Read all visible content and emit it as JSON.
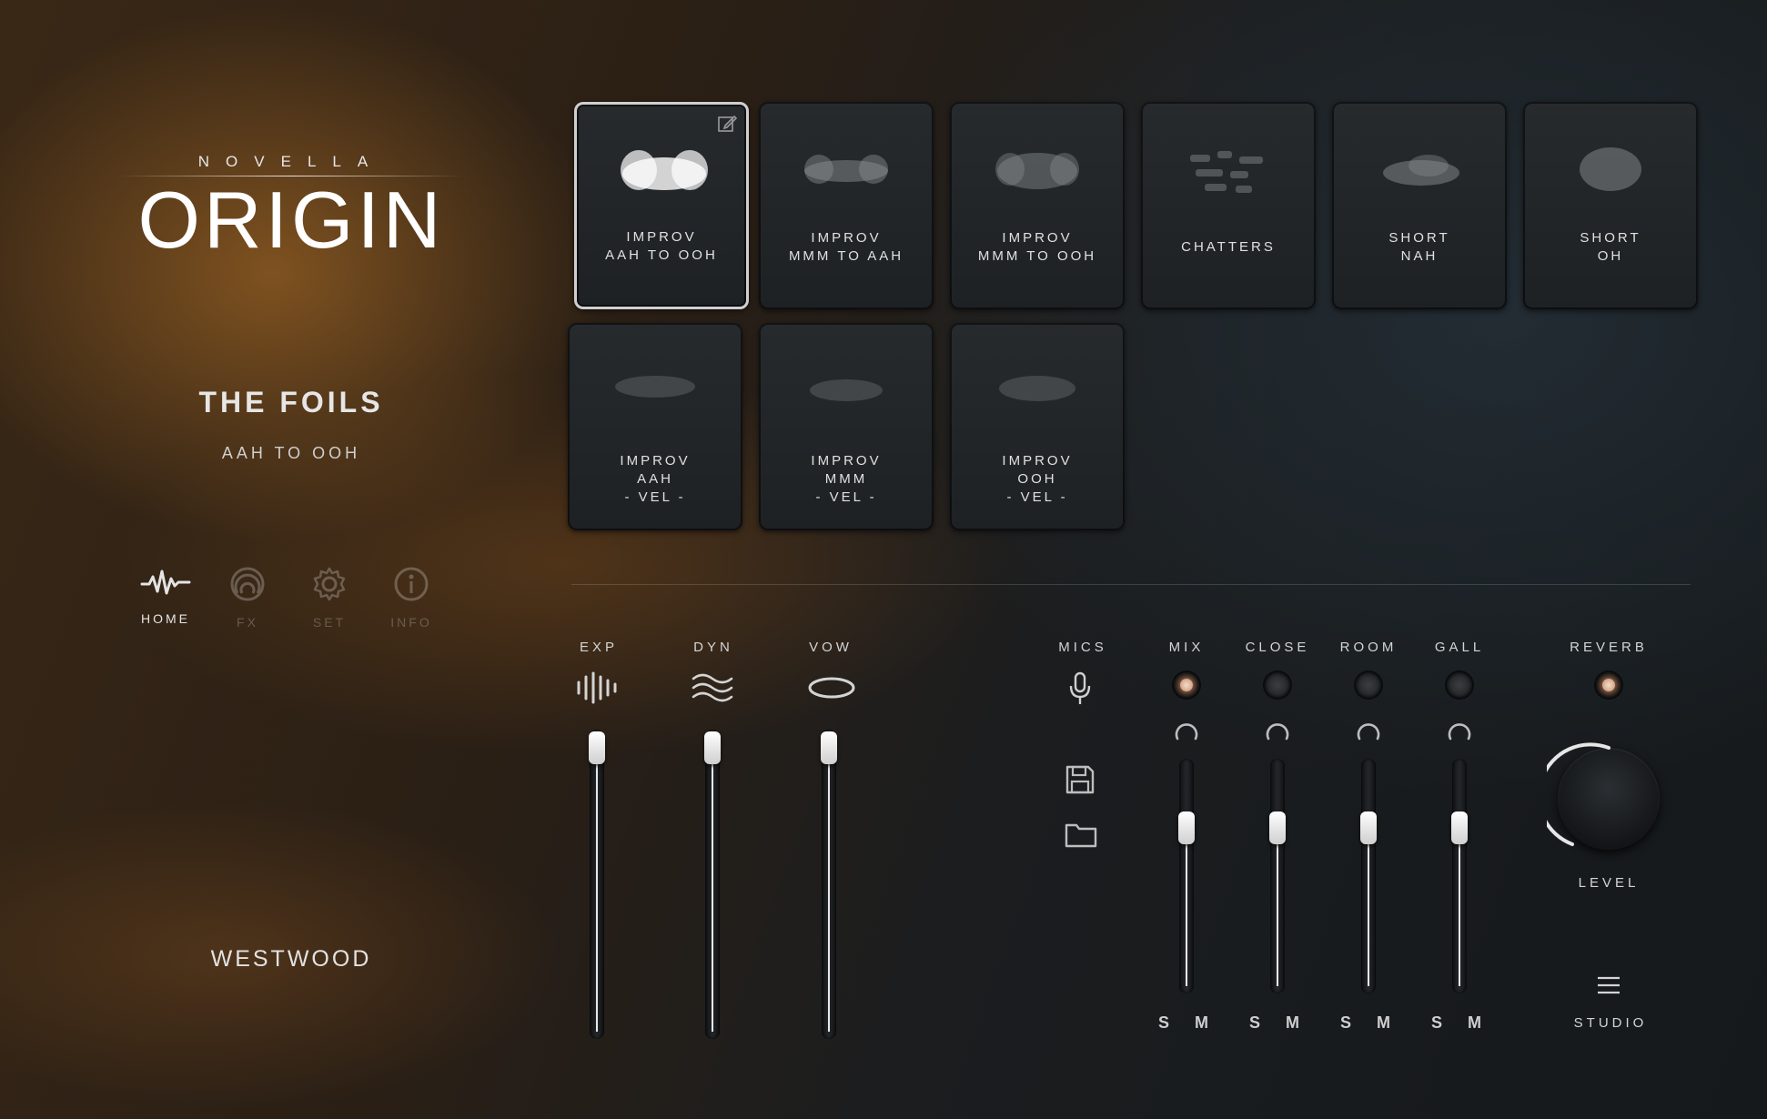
{
  "brand": {
    "top": "NOVELLA",
    "main": "ORIGIN"
  },
  "patch": {
    "title": "THE FOILS",
    "subtitle": "AAH TO OOH"
  },
  "nav": [
    {
      "label": "HOME",
      "icon": "waveform-icon",
      "active": true
    },
    {
      "label": "FX",
      "icon": "fx-rings-icon",
      "active": false
    },
    {
      "label": "SET",
      "icon": "gear-icon",
      "active": false
    },
    {
      "label": "INFO",
      "icon": "info-icon",
      "active": false
    }
  ],
  "maker": "WESTWOOD",
  "pads": [
    {
      "lines": [
        "IMPROV",
        "AAH TO OOH"
      ],
      "selected": true
    },
    {
      "lines": [
        "IMPROV",
        "MMM TO AAH"
      ],
      "selected": false
    },
    {
      "lines": [
        "IMPROV",
        "MMM TO OOH"
      ],
      "selected": false
    },
    {
      "lines": [
        "CHATTERS"
      ],
      "selected": false
    },
    {
      "lines": [
        "SHORT",
        "NAH"
      ],
      "selected": false
    },
    {
      "lines": [
        "SHORT",
        "OH"
      ],
      "selected": false
    },
    {
      "lines": [
        "IMPROV",
        "AAH",
        "- VEL -"
      ],
      "selected": false
    },
    {
      "lines": [
        "IMPROV",
        "MMM",
        "- VEL -"
      ],
      "selected": false
    },
    {
      "lines": [
        "IMPROV",
        "OOH",
        "- VEL -"
      ],
      "selected": false
    }
  ],
  "controls": {
    "exp": {
      "label": "EXP",
      "icon": "bars-icon",
      "value": 0.95
    },
    "dyn": {
      "label": "DYN",
      "icon": "waves-icon",
      "value": 0.95
    },
    "vow": {
      "label": "VOW",
      "icon": "ellipse-icon",
      "value": 0.95
    }
  },
  "mics": {
    "label": "MICS",
    "icons": [
      "microphone-icon",
      "save-icon",
      "folder-icon"
    ],
    "channels": [
      {
        "label": "MIX",
        "on": true,
        "value": 0.72,
        "solo": "S",
        "mute": "M"
      },
      {
        "label": "CLOSE",
        "on": false,
        "value": 0.72,
        "solo": "S",
        "mute": "M"
      },
      {
        "label": "ROOM",
        "on": false,
        "value": 0.72,
        "solo": "S",
        "mute": "M"
      },
      {
        "label": "GALL",
        "on": false,
        "value": 0.72,
        "solo": "S",
        "mute": "M"
      }
    ]
  },
  "reverb": {
    "label": "REVERB",
    "on": true,
    "knob_label": "LEVEL",
    "level": 0.45
  },
  "studio": {
    "label": "STUDIO",
    "icon": "menu-icon"
  },
  "colors": {
    "accent_led": "#e8b49a",
    "text": "#d9d9d9",
    "background": "#1b1d1f"
  }
}
